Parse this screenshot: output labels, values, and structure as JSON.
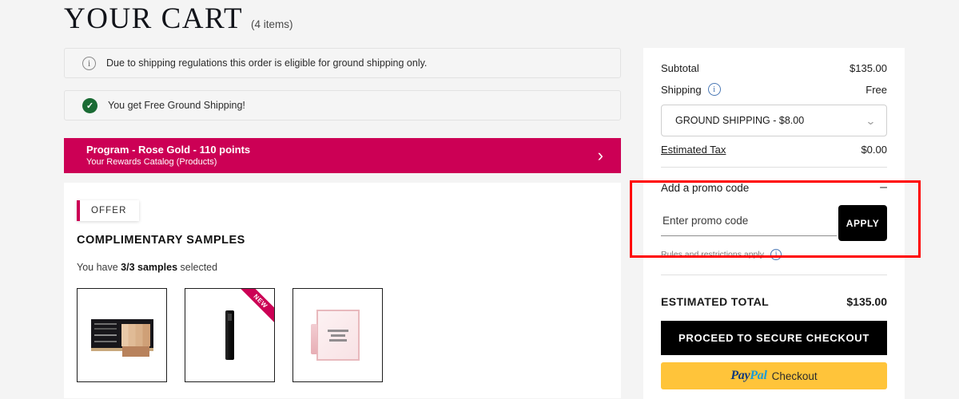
{
  "header": {
    "title": "YOUR CART",
    "item_count": "(4 items)"
  },
  "notices": [
    {
      "icon": "info-icon",
      "text": "Due to shipping regulations this order is eligible for ground shipping only."
    },
    {
      "icon": "check-circle-icon",
      "text": "You get Free Ground Shipping!"
    }
  ],
  "rewards_banner": {
    "title": "Program - Rose Gold - 110 points",
    "subtitle": "Your Rewards Catalog (Products)",
    "chevron": "›",
    "color": "#cc0055"
  },
  "offer": {
    "tag_label": "OFFER",
    "heading": "COMPLIMENTARY SAMPLES",
    "status_prefix": "You have ",
    "status_bold": "3/3 samples",
    "status_suffix": " selected",
    "samples": [
      {
        "name": "makeup-palette-sample",
        "badge": ""
      },
      {
        "name": "mascara-tube-sample",
        "badge": "NEW"
      },
      {
        "name": "la-vie-est-belle-vial-sample",
        "badge": ""
      }
    ]
  },
  "summary": {
    "subtotal_label": "Subtotal",
    "subtotal_value": "$135.00",
    "shipping_label": "Shipping",
    "shipping_value": "Free",
    "shipping_info_icon": "info-icon",
    "shipping_option": "GROUND SHIPPING - $8.00",
    "shipping_chevron": "⌄",
    "tax_label": "Estimated Tax",
    "tax_value": "$0.00"
  },
  "promo": {
    "heading": "Add a promo code",
    "collapse_icon": "–",
    "placeholder": "Enter promo code",
    "value": "",
    "apply_label": "APPLY",
    "rules_text": "Rules and restrictions apply.",
    "rules_info_icon": "info-icon"
  },
  "total": {
    "label": "ESTIMATED TOTAL",
    "value": "$135.00"
  },
  "actions": {
    "checkout_label": "PROCEED TO SECURE CHECKOUT",
    "paypal_pay": "Pay",
    "paypal_pal": "Pal",
    "paypal_word": "Checkout"
  },
  "annotation": {
    "color": "#ff0000",
    "target": "promo-code-section"
  }
}
